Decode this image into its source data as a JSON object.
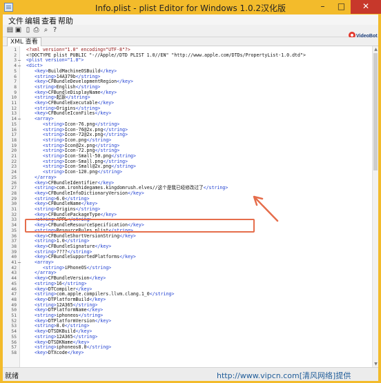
{
  "window": {
    "title": "Info.plist - plist Editor for Windows 1.0.2汉化版",
    "min_label": "–",
    "max_label": "□",
    "close_label": "✕"
  },
  "menu": [
    "文件",
    "编辑",
    "查看",
    "帮助"
  ],
  "toolbar_icons": [
    "open-file-icon",
    "save-icon",
    "new-file-icon",
    "print-icon",
    "find-icon",
    "help-icon"
  ],
  "logo": {
    "name": "VideoBot"
  },
  "tab": {
    "label": "XML 查看"
  },
  "status": {
    "text": "就绪"
  },
  "watermark": "http://www.vipcn.com[清风网络]提供",
  "editor": {
    "lines": [
      {
        "n": "1",
        "fold": "",
        "parts": [
          [
            "pi",
            "<?xml version=\"1.0\" encoding=\"UTF-8\"?>"
          ]
        ],
        "indent": 0
      },
      {
        "n": "2",
        "fold": "",
        "parts": [
          [
            "txt",
            "<!DOCTYPE plist PUBLIC \"-//Apple//DTD PLIST 1.0//EN\" \"http://www.apple.com/DTDs/PropertyList-1.0.dtd\">"
          ]
        ],
        "indent": 0
      },
      {
        "n": "3",
        "fold": "–",
        "parts": [
          [
            "tag",
            "<plist version=\"1.0\">"
          ]
        ],
        "indent": 0
      },
      {
        "n": "4",
        "fold": "–",
        "parts": [
          [
            "tag",
            "<dict>"
          ]
        ],
        "indent": 0
      },
      {
        "n": "5",
        "fold": "",
        "parts": [
          [
            "tag",
            "<key>"
          ],
          [
            "txt",
            "BuildMachineOSBuild"
          ],
          [
            "tag",
            "</key>"
          ]
        ],
        "indent": 1
      },
      {
        "n": "6",
        "fold": "",
        "parts": [
          [
            "tag",
            "<string>"
          ],
          [
            "txt",
            "14A379b"
          ],
          [
            "tag",
            "</string>"
          ]
        ],
        "indent": 1
      },
      {
        "n": "7",
        "fold": "",
        "parts": [
          [
            "tag",
            "<key>"
          ],
          [
            "txt",
            "CFBundleDevelopmentRegion"
          ],
          [
            "tag",
            "</key>"
          ]
        ],
        "indent": 1
      },
      {
        "n": "8",
        "fold": "",
        "parts": [
          [
            "tag",
            "<string>"
          ],
          [
            "txt",
            "English"
          ],
          [
            "tag",
            "</string>"
          ]
        ],
        "indent": 1
      },
      {
        "n": "9",
        "fold": "",
        "parts": [
          [
            "tag",
            "<key>"
          ],
          [
            "txt",
            "CFBundleDisplayName"
          ],
          [
            "tag",
            "</key>"
          ]
        ],
        "indent": 1
      },
      {
        "n": "10",
        "fold": "",
        "parts": [
          [
            "tag",
            "<string>"
          ],
          [
            "txt",
            "起源"
          ],
          [
            "tag",
            "</string>"
          ]
        ],
        "indent": 1
      },
      {
        "n": "11",
        "fold": "",
        "parts": [
          [
            "tag",
            "<key>"
          ],
          [
            "txt",
            "CFBundleExecutable"
          ],
          [
            "tag",
            "</key>"
          ]
        ],
        "indent": 1
      },
      {
        "n": "12",
        "fold": "",
        "parts": [
          [
            "tag",
            "<string>"
          ],
          [
            "txt",
            "Origins"
          ],
          [
            "tag",
            "</string>"
          ]
        ],
        "indent": 1
      },
      {
        "n": "13",
        "fold": "",
        "parts": [
          [
            "tag",
            "<key>"
          ],
          [
            "txt",
            "CFBundleIconFiles"
          ],
          [
            "tag",
            "</key>"
          ]
        ],
        "indent": 1
      },
      {
        "n": "14",
        "fold": "–",
        "parts": [
          [
            "tag",
            "<array>"
          ]
        ],
        "indent": 1
      },
      {
        "n": "15",
        "fold": "",
        "parts": [
          [
            "tag",
            "<string>"
          ],
          [
            "txt",
            "Icon-76.png"
          ],
          [
            "tag",
            "</string>"
          ]
        ],
        "indent": 2
      },
      {
        "n": "16",
        "fold": "",
        "parts": [
          [
            "tag",
            "<string>"
          ],
          [
            "txt",
            "Icon-76@2x.png"
          ],
          [
            "tag",
            "</string>"
          ]
        ],
        "indent": 2
      },
      {
        "n": "17",
        "fold": "",
        "parts": [
          [
            "tag",
            "<string>"
          ],
          [
            "txt",
            "Icon-72@2x.png"
          ],
          [
            "tag",
            "</string>"
          ]
        ],
        "indent": 2
      },
      {
        "n": "18",
        "fold": "",
        "parts": [
          [
            "tag",
            "<string>"
          ],
          [
            "txt",
            "Icon.png"
          ],
          [
            "tag",
            "</string>"
          ]
        ],
        "indent": 2
      },
      {
        "n": "19",
        "fold": "",
        "parts": [
          [
            "tag",
            "<string>"
          ],
          [
            "txt",
            "Icon@2x.png"
          ],
          [
            "tag",
            "</string>"
          ]
        ],
        "indent": 2
      },
      {
        "n": "20",
        "fold": "",
        "parts": [
          [
            "tag",
            "<string>"
          ],
          [
            "txt",
            "Icon-72.png"
          ],
          [
            "tag",
            "</string>"
          ]
        ],
        "indent": 2
      },
      {
        "n": "21",
        "fold": "",
        "parts": [
          [
            "tag",
            "<string>"
          ],
          [
            "txt",
            "Icon-Small-50.png"
          ],
          [
            "tag",
            "</string>"
          ]
        ],
        "indent": 2
      },
      {
        "n": "22",
        "fold": "",
        "parts": [
          [
            "tag",
            "<string>"
          ],
          [
            "txt",
            "Icon-Small.png"
          ],
          [
            "tag",
            "</string>"
          ]
        ],
        "indent": 2
      },
      {
        "n": "23",
        "fold": "",
        "parts": [
          [
            "tag",
            "<string>"
          ],
          [
            "txt",
            "Icon-Small@2x.png"
          ],
          [
            "tag",
            "</string>"
          ]
        ],
        "indent": 2
      },
      {
        "n": "24",
        "fold": "",
        "parts": [
          [
            "tag",
            "<string>"
          ],
          [
            "txt",
            "Icon-120.png"
          ],
          [
            "tag",
            "</string>"
          ]
        ],
        "indent": 2
      },
      {
        "n": "25",
        "fold": "",
        "parts": [
          [
            "tag",
            "</array>"
          ]
        ],
        "indent": 1
      },
      {
        "n": "26",
        "fold": "",
        "parts": [
          [
            "tag",
            "<key>"
          ],
          [
            "txt",
            "CFBundleIdentifier"
          ],
          [
            "tag",
            "</key>"
          ]
        ],
        "indent": 1
      },
      {
        "n": "27",
        "fold": "",
        "parts": [
          [
            "tag",
            "<string>"
          ],
          [
            "txt",
            "com.ironhidegames.kingdomrush.elves//这个是我已经修改过了"
          ],
          [
            "tag",
            "</string>"
          ]
        ],
        "indent": 1
      },
      {
        "n": "28",
        "fold": "",
        "parts": [
          [
            "tag",
            "<key>"
          ],
          [
            "txt",
            "CFBundleInfoDictionaryVersion"
          ],
          [
            "tag",
            "</key>"
          ]
        ],
        "indent": 1
      },
      {
        "n": "29",
        "fold": "",
        "parts": [
          [
            "tag",
            "<string>"
          ],
          [
            "txt",
            "6.0"
          ],
          [
            "tag",
            "</string>"
          ]
        ],
        "indent": 1
      },
      {
        "n": "30",
        "fold": "",
        "parts": [
          [
            "tag",
            "<key>"
          ],
          [
            "txt",
            "CFBundleName"
          ],
          [
            "tag",
            "</key>"
          ]
        ],
        "indent": 1
      },
      {
        "n": "31",
        "fold": "",
        "parts": [
          [
            "tag",
            "<string>"
          ],
          [
            "txt",
            "Origins"
          ],
          [
            "tag",
            "</string>"
          ]
        ],
        "indent": 1
      },
      {
        "n": "32",
        "fold": "",
        "parts": [
          [
            "tag",
            "<key>"
          ],
          [
            "txt",
            "CFBundlePackageType"
          ],
          [
            "tag",
            "</key>"
          ]
        ],
        "indent": 1
      },
      {
        "n": "33",
        "fold": "",
        "parts": [
          [
            "tag",
            "<string>"
          ],
          [
            "txt",
            "APPL"
          ],
          [
            "tag",
            "</string>"
          ]
        ],
        "indent": 1
      },
      {
        "n": "34",
        "fold": "",
        "parts": [
          [
            "tag",
            "<key>"
          ],
          [
            "txt",
            "CFBundleResourceSpecification"
          ],
          [
            "tag",
            "</key>"
          ]
        ],
        "indent": 1
      },
      {
        "n": "35",
        "fold": "",
        "parts": [
          [
            "tag",
            "<string>"
          ],
          [
            "txt",
            "ResourceRules.plist"
          ],
          [
            "tag",
            "</string>"
          ]
        ],
        "indent": 1
      },
      {
        "n": "36",
        "fold": "",
        "parts": [
          [
            "tag",
            "<key>"
          ],
          [
            "txt",
            "CFBundleShortVersionString"
          ],
          [
            "tag",
            "</key>"
          ]
        ],
        "indent": 1
      },
      {
        "n": "37",
        "fold": "",
        "parts": [
          [
            "tag",
            "<string>"
          ],
          [
            "txt",
            "1.0"
          ],
          [
            "tag",
            "</string>"
          ]
        ],
        "indent": 1
      },
      {
        "n": "38",
        "fold": "",
        "parts": [
          [
            "tag",
            "<key>"
          ],
          [
            "txt",
            "CFBundleSignature"
          ],
          [
            "tag",
            "</key>"
          ]
        ],
        "indent": 1
      },
      {
        "n": "39",
        "fold": "",
        "parts": [
          [
            "tag",
            "<string>"
          ],
          [
            "txt",
            "????"
          ],
          [
            "tag",
            "</string>"
          ]
        ],
        "indent": 1
      },
      {
        "n": "40",
        "fold": "",
        "parts": [
          [
            "tag",
            "<key>"
          ],
          [
            "txt",
            "CFBundleSupportedPlatforms"
          ],
          [
            "tag",
            "</key>"
          ]
        ],
        "indent": 1
      },
      {
        "n": "41",
        "fold": "–",
        "parts": [
          [
            "tag",
            "<array>"
          ]
        ],
        "indent": 1
      },
      {
        "n": "42",
        "fold": "",
        "parts": [
          [
            "tag",
            "<string>"
          ],
          [
            "txt",
            "iPhoneOS"
          ],
          [
            "tag",
            "</string>"
          ]
        ],
        "indent": 2
      },
      {
        "n": "43",
        "fold": "",
        "parts": [
          [
            "tag",
            "</array>"
          ]
        ],
        "indent": 1
      },
      {
        "n": "44",
        "fold": "",
        "parts": [
          [
            "tag",
            "<key>"
          ],
          [
            "txt",
            "CFBundleVersion"
          ],
          [
            "tag",
            "</key>"
          ]
        ],
        "indent": 1
      },
      {
        "n": "45",
        "fold": "",
        "parts": [
          [
            "tag",
            "<string>"
          ],
          [
            "txt",
            "16"
          ],
          [
            "tag",
            "</string>"
          ]
        ],
        "indent": 1
      },
      {
        "n": "46",
        "fold": "",
        "parts": [
          [
            "tag",
            "<key>"
          ],
          [
            "txt",
            "DTCompiler"
          ],
          [
            "tag",
            "</key>"
          ]
        ],
        "indent": 1
      },
      {
        "n": "47",
        "fold": "",
        "parts": [
          [
            "tag",
            "<string>"
          ],
          [
            "txt",
            "com.apple.compilers.llvm.clang.1_0"
          ],
          [
            "tag",
            "</string>"
          ]
        ],
        "indent": 1
      },
      {
        "n": "48",
        "fold": "",
        "parts": [
          [
            "tag",
            "<key>"
          ],
          [
            "txt",
            "DTPlatformBuild"
          ],
          [
            "tag",
            "</key>"
          ]
        ],
        "indent": 1
      },
      {
        "n": "49",
        "fold": "",
        "parts": [
          [
            "tag",
            "<string>"
          ],
          [
            "txt",
            "12A365"
          ],
          [
            "tag",
            "</string>"
          ]
        ],
        "indent": 1
      },
      {
        "n": "50",
        "fold": "",
        "parts": [
          [
            "tag",
            "<key>"
          ],
          [
            "txt",
            "DTPlatformName"
          ],
          [
            "tag",
            "</key>"
          ]
        ],
        "indent": 1
      },
      {
        "n": "51",
        "fold": "",
        "parts": [
          [
            "tag",
            "<string>"
          ],
          [
            "txt",
            "iphoneos"
          ],
          [
            "tag",
            "</string>"
          ]
        ],
        "indent": 1
      },
      {
        "n": "52",
        "fold": "",
        "parts": [
          [
            "tag",
            "<key>"
          ],
          [
            "txt",
            "DTPlatformVersion"
          ],
          [
            "tag",
            "</key>"
          ]
        ],
        "indent": 1
      },
      {
        "n": "53",
        "fold": "",
        "parts": [
          [
            "tag",
            "<string>"
          ],
          [
            "txt",
            "8.0"
          ],
          [
            "tag",
            "</string>"
          ]
        ],
        "indent": 1
      },
      {
        "n": "54",
        "fold": "",
        "parts": [
          [
            "tag",
            "<key>"
          ],
          [
            "txt",
            "DTSDKBuild"
          ],
          [
            "tag",
            "</key>"
          ]
        ],
        "indent": 1
      },
      {
        "n": "55",
        "fold": "",
        "parts": [
          [
            "tag",
            "<string>"
          ],
          [
            "txt",
            "12A365"
          ],
          [
            "tag",
            "</string>"
          ]
        ],
        "indent": 1
      },
      {
        "n": "56",
        "fold": "",
        "parts": [
          [
            "tag",
            "<key>"
          ],
          [
            "txt",
            "DTSDKName"
          ],
          [
            "tag",
            "</key>"
          ]
        ],
        "indent": 1
      },
      {
        "n": "57",
        "fold": "",
        "parts": [
          [
            "tag",
            "<string>"
          ],
          [
            "txt",
            "iphoneos8.0"
          ],
          [
            "tag",
            "</string>"
          ]
        ],
        "indent": 1
      },
      {
        "n": "58",
        "fold": "",
        "parts": [
          [
            "tag",
            "<key>"
          ],
          [
            "txt",
            "DTXcode"
          ],
          [
            "tag",
            "</key>"
          ]
        ],
        "indent": 1
      }
    ]
  },
  "annotation": {
    "highlight_color": "#e56d4b"
  }
}
